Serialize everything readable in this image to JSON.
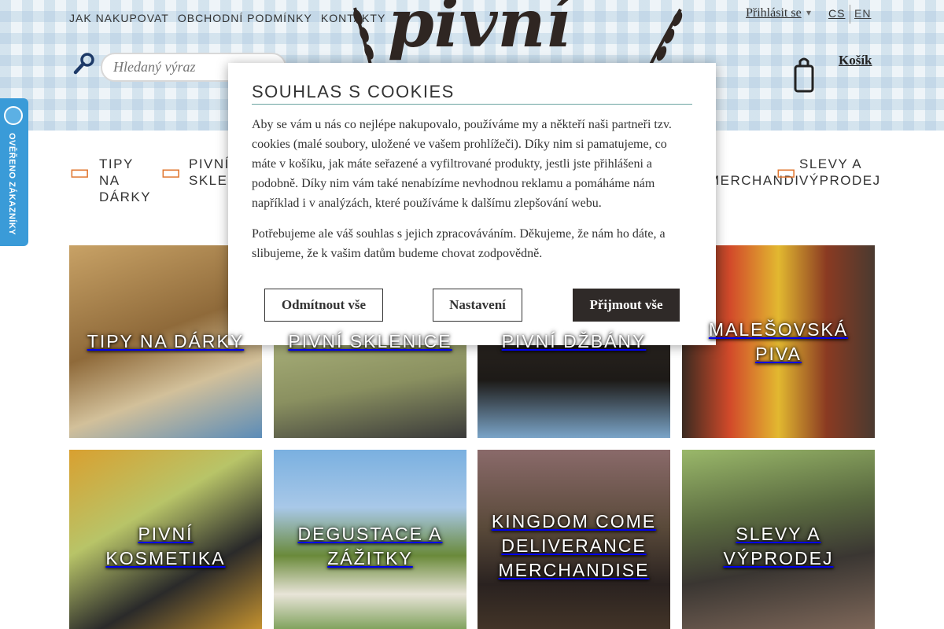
{
  "topnav": {
    "items": [
      "JAK NAKUPOVAT",
      "OBCHODNÍ PODMÍNKY",
      "KONTAKTY"
    ]
  },
  "account": {
    "login_label": "Přihlásit se",
    "lang_cs": "CS",
    "lang_en": "EN"
  },
  "search": {
    "placeholder": "Hledaný výraz"
  },
  "logo": {
    "text": "pivní"
  },
  "cart": {
    "label": "Košík"
  },
  "badge": {
    "text": "Ověřeno zákazníky"
  },
  "categories": [
    {
      "label": "TIPY NA DÁRKY"
    },
    {
      "label": "PIVNÍ SKLE"
    },
    {
      "label": "MERCHANDISE"
    },
    {
      "label": "SLEVY A VÝPRODEJ"
    }
  ],
  "tiles": [
    {
      "title": "TIPY NA DÁRKY"
    },
    {
      "title": "PIVNÍ SKLENICE"
    },
    {
      "title": "PIVNÍ DŽBÁNY"
    },
    {
      "title": "MALEŠOVSKÁ PIVA"
    },
    {
      "title": "PIVNÍ KOSMETIKA"
    },
    {
      "title": "DEGUSTACE A ZÁŽITKY"
    },
    {
      "title": "KINGDOM COME DELIVERANCE MERCHANDISE"
    },
    {
      "title": "SLEVY A VÝPRODEJ"
    }
  ],
  "cookie_modal": {
    "title": "SOUHLAS S COOKIES",
    "paragraph1": "Aby se vám u nás co nejlépe nakupovalo, používáme my a někteří naši partneři tzv. cookies (malé soubory, uložené ve vašem prohlížeči). Díky nim si pamatujeme, co máte v košíku, jak máte seřazené a vyfiltrované produkty, jestli jste přihlášeni a podobně. Díky nim vám také nenabízíme nevhodnou reklamu a pomáháme nám například i v analýzách, které používáme k dalšímu zlepšování webu.",
    "paragraph2": "Potřebujeme ale váš souhlas s jejich zpracováváním. Děkujeme, že nám ho dáte, a slibujeme, že k vašim datům budeme chovat zodpovědně.",
    "reject_label": "Odmítnout vše",
    "settings_label": "Nastavení",
    "accept_label": "Přijmout vše"
  },
  "colors": {
    "accent_orange": "#e17832",
    "badge_blue": "#3a9bd8",
    "dark_button": "#2f2a28"
  }
}
